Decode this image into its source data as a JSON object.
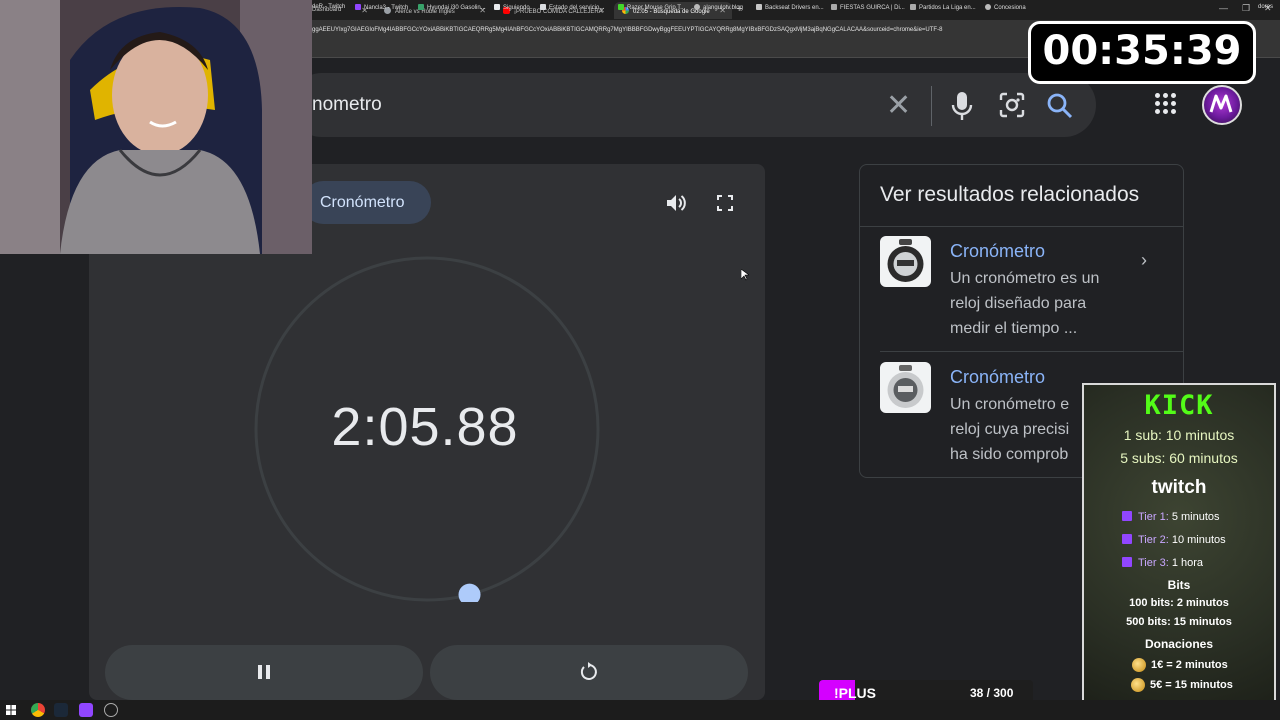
{
  "browser": {
    "tabs": [
      {
        "label": "Dashboard",
        "active": false
      },
      {
        "label": "Alerce vs Roble Inglés",
        "active": false
      },
      {
        "label": "¡PRUEBO COMIDA CALLEJERA",
        "active": false
      },
      {
        "label": "02:05 - Búsqueda de Google",
        "active": true
      }
    ],
    "url": "ggAEEUYIxg7GIAEGIoFMg4IABBFGCcYOxiABBiKBTIGCAEQRRg5Mg4IAhBFGCcYOxiABBiKBTIGCAMQRRg7MgYIBBBFGDwyBggFEEUYPTIGCAYQRRg8MgYIBxBFGDzSAQgxMjM3ajBqNGgCALACAA&sourceid=chrome&ie=UTF-8",
    "bookmarks": [
      "deR - Twitch",
      "Nancla3 - Twitch",
      "Hyundai i30 Gasolin...",
      "Siguiendo",
      "Estado del servicio...",
      "Razer Mouse Grip T...",
      "alangulotv.blog",
      "Backseat Drivers en...",
      "FIESTAS GUIRCA | Di...",
      "Partidos La Liga en...",
      "Concesiona",
      "dores"
    ]
  },
  "search": {
    "query": "nometro"
  },
  "stopwatch": {
    "chip_label": "Cronómetro",
    "time": "2:05.88",
    "progress_fraction": 0.46,
    "colors": {
      "track": "#3c4043",
      "knob": "#aecbfa"
    }
  },
  "related": {
    "title": "Ver resultados relacionados",
    "items": [
      {
        "name": "Cronómetro",
        "desc": "Un cronómetro es un reloj diseñado para medir el tiempo ..."
      },
      {
        "name": "Cronómetro",
        "desc": "Un cronómetro e reloj cuya precisi ha sido comprob"
      }
    ]
  },
  "stream_timer": "00:35:39",
  "panel": {
    "kick_title": "KICK",
    "sub1": "1 sub: 10 minutos",
    "sub5": "5 subs: 60 minutos",
    "twitch_title": "twitch",
    "tiers": [
      {
        "tier": "Tier 1:",
        "value": "5 minutos"
      },
      {
        "tier": "Tier 2:",
        "value": "10 minutos"
      },
      {
        "tier": "Tier 3:",
        "value": "1 hora"
      }
    ],
    "bits_title": "Bits",
    "bits1": "100 bits: 2 minutos",
    "bits2": "500 bits: 15 minutos",
    "donations_title": "Donaciones",
    "don1": "1€ = 2 minutos",
    "don2": "5€ = 15 minutos"
  },
  "plus": {
    "label": "!PLUS",
    "count": "38 / 300",
    "current": 38,
    "max": 300
  }
}
